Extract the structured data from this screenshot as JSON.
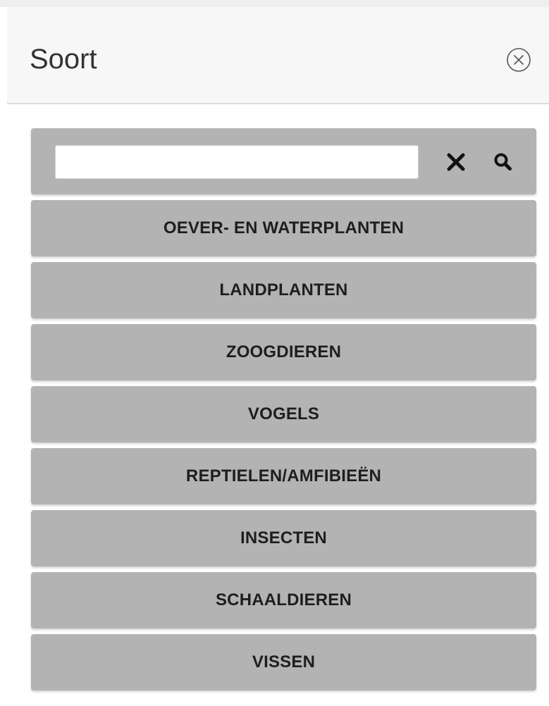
{
  "panel": {
    "title": "Soort",
    "close_icon": "circle-close-icon"
  },
  "search": {
    "value": "",
    "placeholder": "",
    "clear_icon": "close-x-icon",
    "search_icon": "search-icon"
  },
  "categories": [
    {
      "label": "OEVER- EN WATERPLANTEN"
    },
    {
      "label": "LANDPLANTEN"
    },
    {
      "label": "ZOOGDIEREN"
    },
    {
      "label": "VOGELS"
    },
    {
      "label": "REPTIELEN/AMFIBIEËN"
    },
    {
      "label": "INSECTEN"
    },
    {
      "label": "SCHAALDIEREN"
    },
    {
      "label": "VISSEN"
    }
  ],
  "colors": {
    "item_background": "#b3b3b3",
    "header_background": "#f7f7f7",
    "text": "#1e1e1e"
  }
}
